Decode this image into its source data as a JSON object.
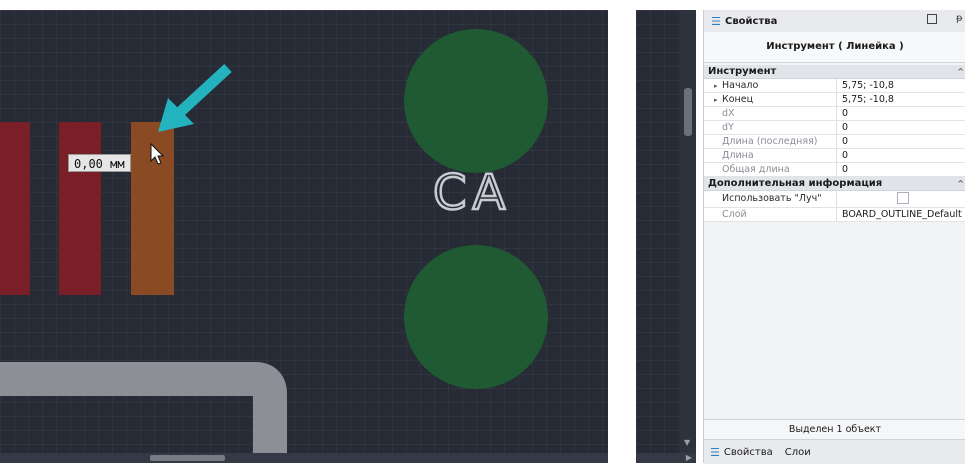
{
  "canvas": {
    "measure_value": "0,00 мм",
    "silkscreen_text": "CA"
  },
  "panel": {
    "title": "Свойства",
    "tool_title": "Инструмент ( Линейка )",
    "categories": [
      {
        "name": "Инструмент",
        "rows": [
          {
            "name": "Начало",
            "value": "5,75; -10,8"
          },
          {
            "name": "Конец",
            "value": "5,75; -10,8"
          },
          {
            "name": "dX",
            "value": "0"
          },
          {
            "name": "dY",
            "value": "0"
          },
          {
            "name": "Длина (последняя)",
            "value": "0"
          },
          {
            "name": "Длина",
            "value": "0"
          },
          {
            "name": "Общая длина",
            "value": "0"
          }
        ]
      },
      {
        "name": "Дополнительная информация",
        "rows": [
          {
            "name": "Использовать \"Луч\"",
            "value": ""
          },
          {
            "name": "Слой",
            "value": "BOARD_OUTLINE_Default"
          }
        ]
      }
    ],
    "status": "Выделен 1 объект",
    "tabs": [
      {
        "label": "Свойства"
      },
      {
        "label": "Слои"
      }
    ]
  },
  "colors": {
    "canvas_bg": "#262b35",
    "pad_red": "#7a1f28",
    "pad_orange": "#8a4a24",
    "via_green": "#1f5a33",
    "outline_gray": "#8c8f95",
    "arrow_teal": "#22b3bf"
  },
  "icons": {
    "panel_icon": "properties-icon",
    "cursor": "mouse-pointer-icon",
    "annotation": "arrow-icon"
  }
}
